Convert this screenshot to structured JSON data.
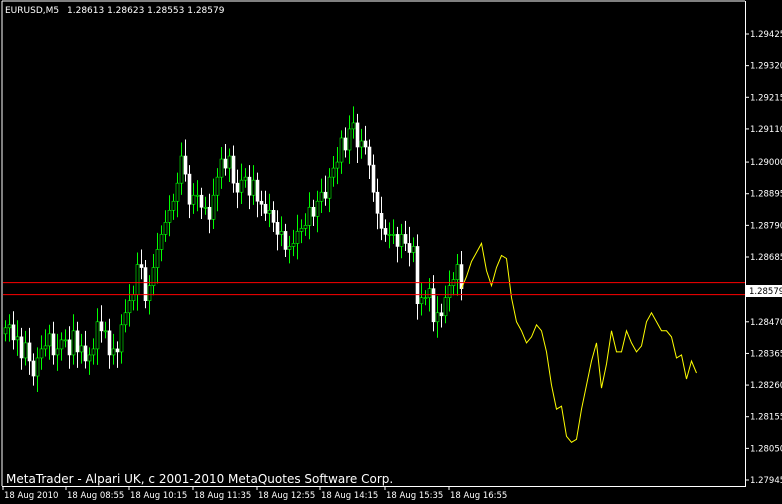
{
  "header": {
    "symbol": "EURUSD,M5",
    "ohlc": "1.28613 1.28623 1.28553 1.28579"
  },
  "footer": {
    "copyright": "MetaTrader - Alpari UK, c 2001-2010 MetaQuotes Software Corp."
  },
  "colors": {
    "background": "#000000",
    "axis": "#ffffff",
    "candle_up": "#00ff00",
    "candle_down": "#ffffff",
    "forecast_line": "#ffff00",
    "bid_line": "#ff0000",
    "price_box": "#ffffff"
  },
  "chart_data": {
    "type": "candlestick",
    "ylim": [
      1.2788,
      1.2952
    ],
    "y_ticks": [
      "1.29425",
      "1.29320",
      "1.29215",
      "1.29110",
      "1.29000",
      "1.28895",
      "1.28790",
      "1.28685",
      "1.28470",
      "1.28365",
      "1.28260",
      "1.28155",
      "1.28050",
      "1.27945"
    ],
    "x_ticks": [
      "18 Aug 2010",
      "18 Aug 08:55",
      "18 Aug 10:15",
      "18 Aug 11:35",
      "18 Aug 12:55",
      "18 Aug 14:15",
      "18 Aug 15:35",
      "18 Aug 16:55"
    ],
    "current_price": "1.28579",
    "bid_lines": [
      1.286,
      1.2856
    ],
    "price_path": [
      1.2845,
      1.2846,
      1.2841,
      1.2842,
      1.2835,
      1.284,
      1.2834,
      1.2829,
      1.2835,
      1.2838,
      1.2839,
      1.2843,
      1.2836,
      1.2838,
      1.2841,
      1.2841,
      1.2836,
      1.2844,
      1.2837,
      1.2839,
      1.2834,
      1.2836,
      1.2838,
      1.2847,
      1.2844,
      1.2844,
      1.2836,
      1.2838,
      1.2837,
      1.2846,
      1.285,
      1.2854,
      1.2856,
      1.2866,
      1.2865,
      1.2854,
      1.2859,
      1.2865,
      1.2871,
      1.2876,
      1.288,
      1.2884,
      1.2887,
      1.2893,
      1.2902,
      1.2896,
      1.2886,
      1.2889,
      1.2889,
      1.2885,
      1.2885,
      1.2881,
      1.2889,
      1.2895,
      1.2901,
      1.2898,
      1.2902,
      1.2893,
      1.289,
      1.2894,
      1.2895,
      1.2889,
      1.2894,
      1.2887,
      1.2886,
      1.2883,
      1.2884,
      1.288,
      1.2876,
      1.2877,
      1.2871,
      1.2872,
      1.2873,
      1.2877,
      1.2878,
      1.2879,
      1.2885,
      1.2882,
      1.2887,
      1.289,
      1.2888,
      1.2895,
      1.2898,
      1.29,
      1.2908,
      1.2904,
      1.2911,
      1.2913,
      1.2905,
      1.2907,
      1.2905,
      1.2899,
      1.289,
      1.2883,
      1.2878,
      1.2876,
      1.2876,
      1.2876,
      1.2872,
      1.2876,
      1.2873,
      1.287,
      1.2872,
      1.2853,
      1.2855,
      1.2855,
      1.2858,
      1.2847,
      1.285,
      1.2849,
      1.2855,
      1.2859,
      1.2861,
      1.2866,
      1.2858
    ],
    "forecast": [
      1.2858,
      1.2862,
      1.2867,
      1.287,
      1.2873,
      1.2864,
      1.2859,
      1.2865,
      1.2869,
      1.2868,
      1.2855,
      1.2847,
      1.2844,
      1.284,
      1.2842,
      1.2846,
      1.2844,
      1.2837,
      1.2826,
      1.2818,
      1.2819,
      1.2809,
      1.2807,
      1.2808,
      1.2818,
      1.2826,
      1.2834,
      1.284,
      1.2825,
      1.2833,
      1.2844,
      1.2837,
      1.2837,
      1.2844,
      1.284,
      1.2837,
      1.2839,
      1.2847,
      1.285,
      1.2847,
      1.2844,
      1.2844,
      1.2842,
      1.2835,
      1.2836,
      1.2828,
      1.2834,
      1.283
    ]
  }
}
